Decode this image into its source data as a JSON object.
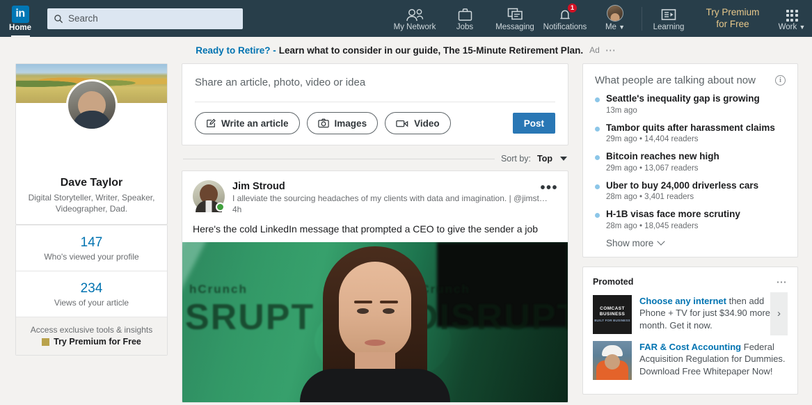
{
  "navbar": {
    "logo_text": "in",
    "home_label": "Home",
    "search_placeholder": "Search",
    "items": [
      {
        "label": "My Network",
        "icon": "people-icon"
      },
      {
        "label": "Jobs",
        "icon": "briefcase-icon"
      },
      {
        "label": "Messaging",
        "icon": "messaging-icon"
      },
      {
        "label": "Notifications",
        "icon": "bell-icon",
        "badge": "1"
      },
      {
        "label": "Me",
        "icon": "avatar-icon"
      }
    ],
    "learning_label": "Learning",
    "premium_line1": "Try Premium",
    "premium_line2": "for Free",
    "work_label": "Work",
    "colors": {
      "header_bg": "#283e4a",
      "logo_blue": "#0077b5",
      "premium_gold": "#e7c88b",
      "badge_red": "#d11124"
    }
  },
  "ad_banner": {
    "link_text": "Ready to Retire? -",
    "body_text": "Learn what to consider in our guide, The 15-Minute Retirement Plan.",
    "ad_label": "Ad",
    "more_icon": "ellipsis-icon"
  },
  "profile": {
    "name": "Dave Taylor",
    "tagline": "Digital Storyteller, Writer, Speaker, Videographer, Dad.",
    "stats": [
      {
        "value": "147",
        "label": "Who's viewed your profile"
      },
      {
        "value": "234",
        "label": "Views of your article"
      }
    ],
    "premium_prompt": "Access exclusive tools & insights",
    "premium_cta": "Try Premium for Free"
  },
  "share_box": {
    "prompt": "Share an article, photo, video or idea",
    "buttons": [
      {
        "label": "Write an article",
        "icon": "write-icon"
      },
      {
        "label": "Images",
        "icon": "camera-icon"
      },
      {
        "label": "Video",
        "icon": "video-icon"
      }
    ],
    "post_label": "Post"
  },
  "sort": {
    "label": "Sort by:",
    "value": "Top"
  },
  "post": {
    "author": "Jim Stroud",
    "headline": "I alleviate the sourcing headaches of my clients with data and imagination. | @jimst…",
    "time": "4h",
    "text": "Here's the cold LinkedIn message that prompted a CEO to give the sender a job",
    "menu_icon": "ellipsis-icon",
    "image_alt_text_left_1": "hCrunch",
    "image_alt_text_left_2": "SRUPT",
    "image_alt_text_right_1": "hCrunch",
    "image_alt_text_right_2": "DISRUPT"
  },
  "news": {
    "title": "What people are talking about now",
    "info_icon": "info-icon",
    "items": [
      {
        "headline": "Seattle's inequality gap is growing",
        "meta": "13m ago"
      },
      {
        "headline": "Tambor quits after harassment claims",
        "meta": "29m ago • 14,404 readers"
      },
      {
        "headline": "Bitcoin reaches new high",
        "meta": "29m ago • 13,067 readers"
      },
      {
        "headline": "Uber to buy 24,000 driverless cars",
        "meta": "28m ago • 3,401 readers"
      },
      {
        "headline": "H-1B visas face more scrutiny",
        "meta": "28m ago • 18,045 readers"
      }
    ],
    "show_more": "Show more"
  },
  "promoted": {
    "title": "Promoted",
    "menu_icon": "ellipsis-icon",
    "next_icon": "chevron-right-icon",
    "items": [
      {
        "thumb_brand": "COMCAST BUSINESS",
        "thumb_sub": "BUILT FOR BUSINESS",
        "title": "Choose any internet",
        "description": "then add Phone + TV for just $34.90 more per month. Get it now."
      },
      {
        "title": "FAR & Cost Accounting",
        "description": "Federal Acquisition Regulation for Dummies. Download Free Whitepaper Now!"
      }
    ]
  }
}
